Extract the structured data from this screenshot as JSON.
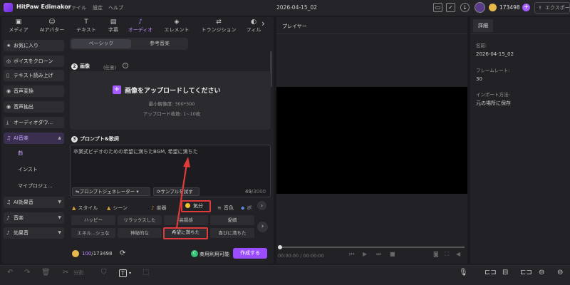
{
  "titlebar": {
    "app_name": "HitPaw Edimakor",
    "menu": [
      "ファイル",
      "設定",
      "ヘルプ"
    ],
    "project_name": "2026-04-15_02",
    "coins": "173498",
    "export_label": "エクスポート"
  },
  "tabs": [
    {
      "label": "メディア",
      "icon": "media-icon"
    },
    {
      "label": "AIアバター",
      "icon": "avatar-icon"
    },
    {
      "label": "テキスト",
      "icon": "text-icon"
    },
    {
      "label": "字幕",
      "icon": "subtitle-icon"
    },
    {
      "label": "オーディオ",
      "icon": "music-note-icon",
      "active": true
    },
    {
      "label": "エレメント",
      "icon": "element-icon"
    },
    {
      "label": "トランジション",
      "icon": "transition-icon"
    },
    {
      "label": "フィル",
      "icon": "filter-icon"
    }
  ],
  "sidebar": {
    "items": [
      {
        "label": "お気に入り"
      },
      {
        "label": "ボイスをクローン"
      },
      {
        "label": "テキスト読み上げ"
      },
      {
        "label": "音声変換"
      },
      {
        "label": "音声抽出"
      },
      {
        "label": "オーディオダウ..."
      },
      {
        "label": "AI音楽"
      },
      {
        "label": "AI効果音"
      },
      {
        "label": "音楽"
      },
      {
        "label": "効果音"
      }
    ],
    "subitems": [
      "曲",
      "インスト",
      "マイプロジェ..."
    ]
  },
  "segment": {
    "basic": "ベーシック",
    "reference": "参考音楽"
  },
  "image_section": {
    "number": "2",
    "title": "画像",
    "optional": "(任意)",
    "upload_title": "画像をアップロードしてください",
    "min_resolution": "最小解像度: 300*300",
    "upload_count": "アップロード枚数: 1~10枚"
  },
  "prompt_section": {
    "number": "3",
    "title": "プロンプト&歌詞",
    "text": "卒業式ビデオのための希望に満ちたBGM, 希望に満ちた",
    "generator_button": "プロンプトジェネレーター",
    "sample_button": "サンプルを試す",
    "char_count": "49",
    "char_max": "/3000"
  },
  "categories": [
    {
      "label": "スタイル"
    },
    {
      "label": "シーン"
    },
    {
      "label": "楽器"
    },
    {
      "label": "気分",
      "selected": true
    },
    {
      "label": "音色"
    },
    {
      "label": "ボ"
    }
  ],
  "mood_chips": [
    "ハッピー",
    "リラックスした",
    "高揚感",
    "愛嬌",
    "エネル...シュな",
    "神秘的な",
    "希望に満ちた",
    "喜びに満ちた"
  ],
  "footer": {
    "credits_used": "100",
    "credits_total": "/173498",
    "commercial": "商用利用可能",
    "create_button": "作成する"
  },
  "player": {
    "title": "プレイヤー",
    "time": "00:00:00 / 00:00:00"
  },
  "properties": {
    "tab": "詳細",
    "name_label": "名前:",
    "name_value": "2026-04-15_02",
    "framerate_label": "フレームレート:",
    "framerate_value": "30",
    "import_label": "インポート方法:",
    "import_value": "元の場所に保存"
  },
  "toolbar": {
    "split_label": "分割"
  },
  "colors": {
    "accent": "#9a4dff",
    "highlight_box": "#e03a3a",
    "coin": "#e8b84a"
  }
}
